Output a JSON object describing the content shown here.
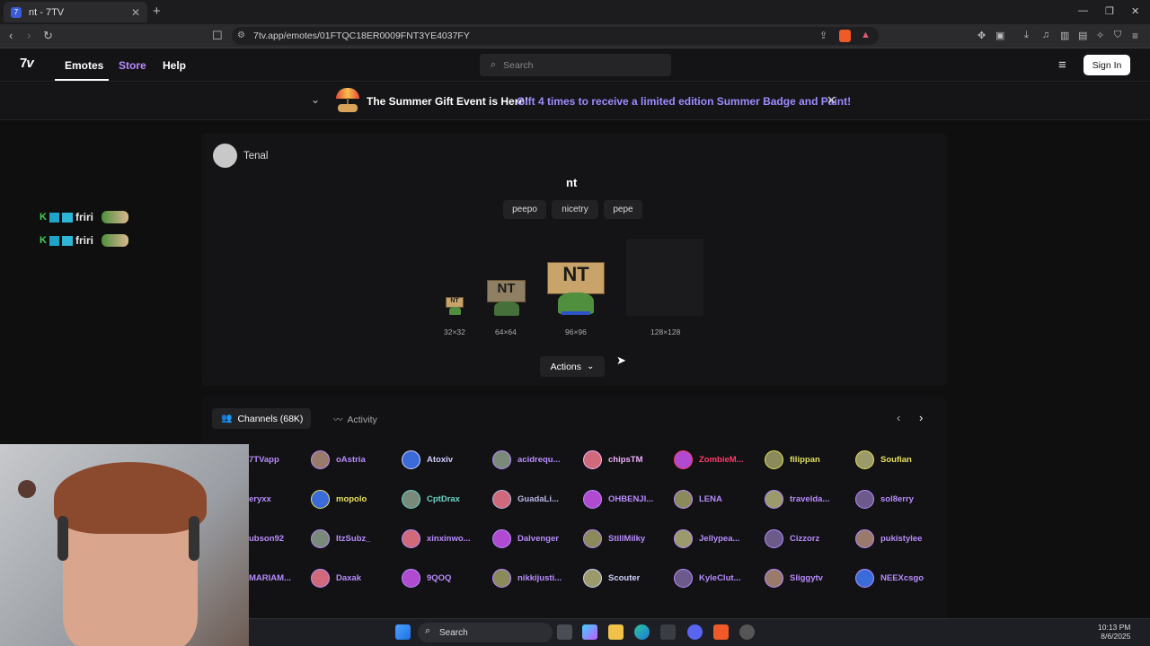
{
  "browser": {
    "tab_title": "nt - 7TV",
    "url": "7tv.app/emotes/01FTQC18ER0009FNT3YE4037FY",
    "new_tab_symbol": "+"
  },
  "site": {
    "logo": "7tv",
    "nav": [
      "Emotes",
      "Store",
      "Help"
    ],
    "search_placeholder": "Search",
    "sign_in": "Sign In"
  },
  "banner": {
    "title": "The Summer Gift Event is Here!",
    "link": "Gift 4 times to receive a limited edition Summer Badge and Paint!"
  },
  "emote": {
    "owner": "Tenal",
    "name": "nt",
    "tags": [
      "peepo",
      "nicetry",
      "pepe"
    ],
    "sign_text": "NT",
    "sizes": [
      "32×32",
      "64×64",
      "96×96",
      "128×128"
    ],
    "actions_label": "Actions"
  },
  "sidebar_emote_text": "friri",
  "channels": {
    "tab_channels": "Channels (68K)",
    "tab_activity": "Activity",
    "rows": [
      [
        {
          "name": "7TVapp",
          "color": "#b98cff"
        },
        {
          "name": "oAstria",
          "color": "#b98cff"
        },
        {
          "name": "Atoxiv",
          "color": "#d0d0ff"
        },
        {
          "name": "acidrequ...",
          "color": "#b98cff"
        },
        {
          "name": "chipsTM",
          "color": "#f0b0ff"
        },
        {
          "name": "ZombieM...",
          "color": "#ff3b6b"
        },
        {
          "name": "filippan",
          "color": "#e0e060"
        },
        {
          "name": "Soufian",
          "color": "#e8e060"
        }
      ],
      [
        {
          "name": "eryxx",
          "color": "#b98cff"
        },
        {
          "name": "mopolo",
          "color": "#e8e060"
        },
        {
          "name": "CptDrax",
          "color": "#6ad6c8"
        },
        {
          "name": "GuadaLi...",
          "color": "#b8b8e8"
        },
        {
          "name": "OHBENJI...",
          "color": "#b98cff"
        },
        {
          "name": "LENA",
          "color": "#b98cff"
        },
        {
          "name": "travelda...",
          "color": "#b98cff"
        },
        {
          "name": "sol8erry",
          "color": "#b98cff"
        }
      ],
      [
        {
          "name": "ubson92",
          "color": "#b98cff"
        },
        {
          "name": "ItzSubz_",
          "color": "#b98cff"
        },
        {
          "name": "xinxinwo...",
          "color": "#b98cff"
        },
        {
          "name": "Dalvenger",
          "color": "#b98cff"
        },
        {
          "name": "StillMilky",
          "color": "#b98cff"
        },
        {
          "name": "Jellypea...",
          "color": "#b98cff"
        },
        {
          "name": "Cizzorz",
          "color": "#b98cff"
        },
        {
          "name": "pukistylee",
          "color": "#b98cff"
        }
      ],
      [
        {
          "name": "MARIAM...",
          "color": "#b98cff"
        },
        {
          "name": "Daxak",
          "color": "#b98cff"
        },
        {
          "name": "9QOQ",
          "color": "#b98cff"
        },
        {
          "name": "nikkijusti...",
          "color": "#b98cff"
        },
        {
          "name": "Scouter",
          "color": "#d0d0ff"
        },
        {
          "name": "KyleClut...",
          "color": "#b98cff"
        },
        {
          "name": "Sliggytv",
          "color": "#b98cff"
        },
        {
          "name": "NEEXcsgo",
          "color": "#b98cff"
        }
      ]
    ]
  },
  "taskbar": {
    "search": "Search",
    "time": "10:13 PM",
    "date": "8/6/2025"
  },
  "colors": {
    "accent": "#9c8cff",
    "store": "#b98cff",
    "background": "#0f0f10"
  }
}
